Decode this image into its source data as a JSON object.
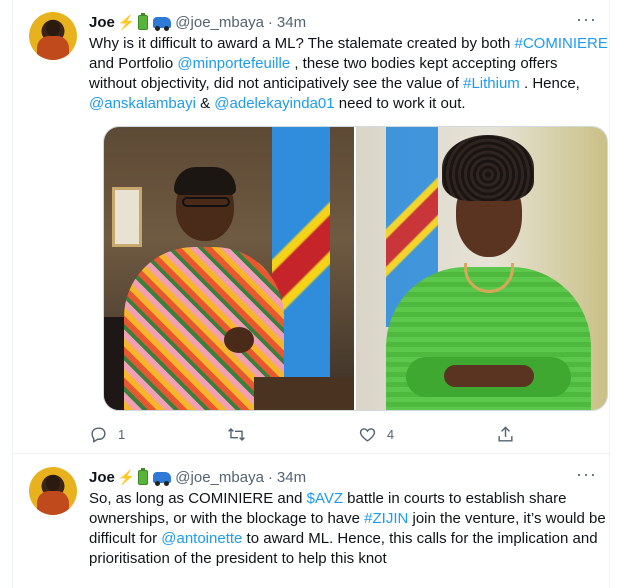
{
  "tweets": [
    {
      "name": "Joe",
      "emojis": [
        "lightning-emoji",
        "battery-emoji",
        "car-emoji"
      ],
      "handle": "@joe_mbaya",
      "dot": "·",
      "time": "34m",
      "more": "···",
      "text": [
        {
          "t": "Why is it difficult to award a ML? The stalemate created by both "
        },
        {
          "t": "#COMINIERE",
          "link": true
        },
        {
          "t": " and Portfolio "
        },
        {
          "t": "@minportefeuille",
          "link": true
        },
        {
          "t": " , these two bodies kept accepting offers without objectivity, did not anticipatively see the value of "
        },
        {
          "t": "#Lithium",
          "link": true
        },
        {
          "t": " . Hence, "
        },
        {
          "t": "@anskalambayi",
          "link": true
        },
        {
          "t": " & "
        },
        {
          "t": "@adelekayinda01",
          "link": true
        },
        {
          "t": "  need to work it out."
        }
      ],
      "actions": {
        "reply_count": "1",
        "retweet_count": "",
        "like_count": "4",
        "share_count": ""
      }
    },
    {
      "name": "Joe",
      "emojis": [
        "lightning-emoji",
        "battery-emoji",
        "car-emoji"
      ],
      "handle": "@joe_mbaya",
      "dot": "·",
      "time": "34m",
      "more": "···",
      "text": [
        {
          "t": "So, as long as COMINIERE and "
        },
        {
          "t": "$AVZ",
          "link": true
        },
        {
          "t": " battle in courts to establish share ownerships, or with the blockage to have "
        },
        {
          "t": "#ZIJIN",
          "link": true
        },
        {
          "t": " join the venture, it’s would be difficult for "
        },
        {
          "t": "@antoinette",
          "link": true
        },
        {
          "t": " to award ML. Hence, this calls for the implication and prioritisation of the president to help this knot"
        }
      ]
    }
  ],
  "colors": {
    "link": "#1d9bf0",
    "muted": "#536471",
    "text": "#0f1419",
    "border": "#eff3f4"
  },
  "icons": {
    "reply": "reply-icon",
    "retweet": "retweet-icon",
    "like": "heart-icon",
    "share": "share-icon"
  }
}
